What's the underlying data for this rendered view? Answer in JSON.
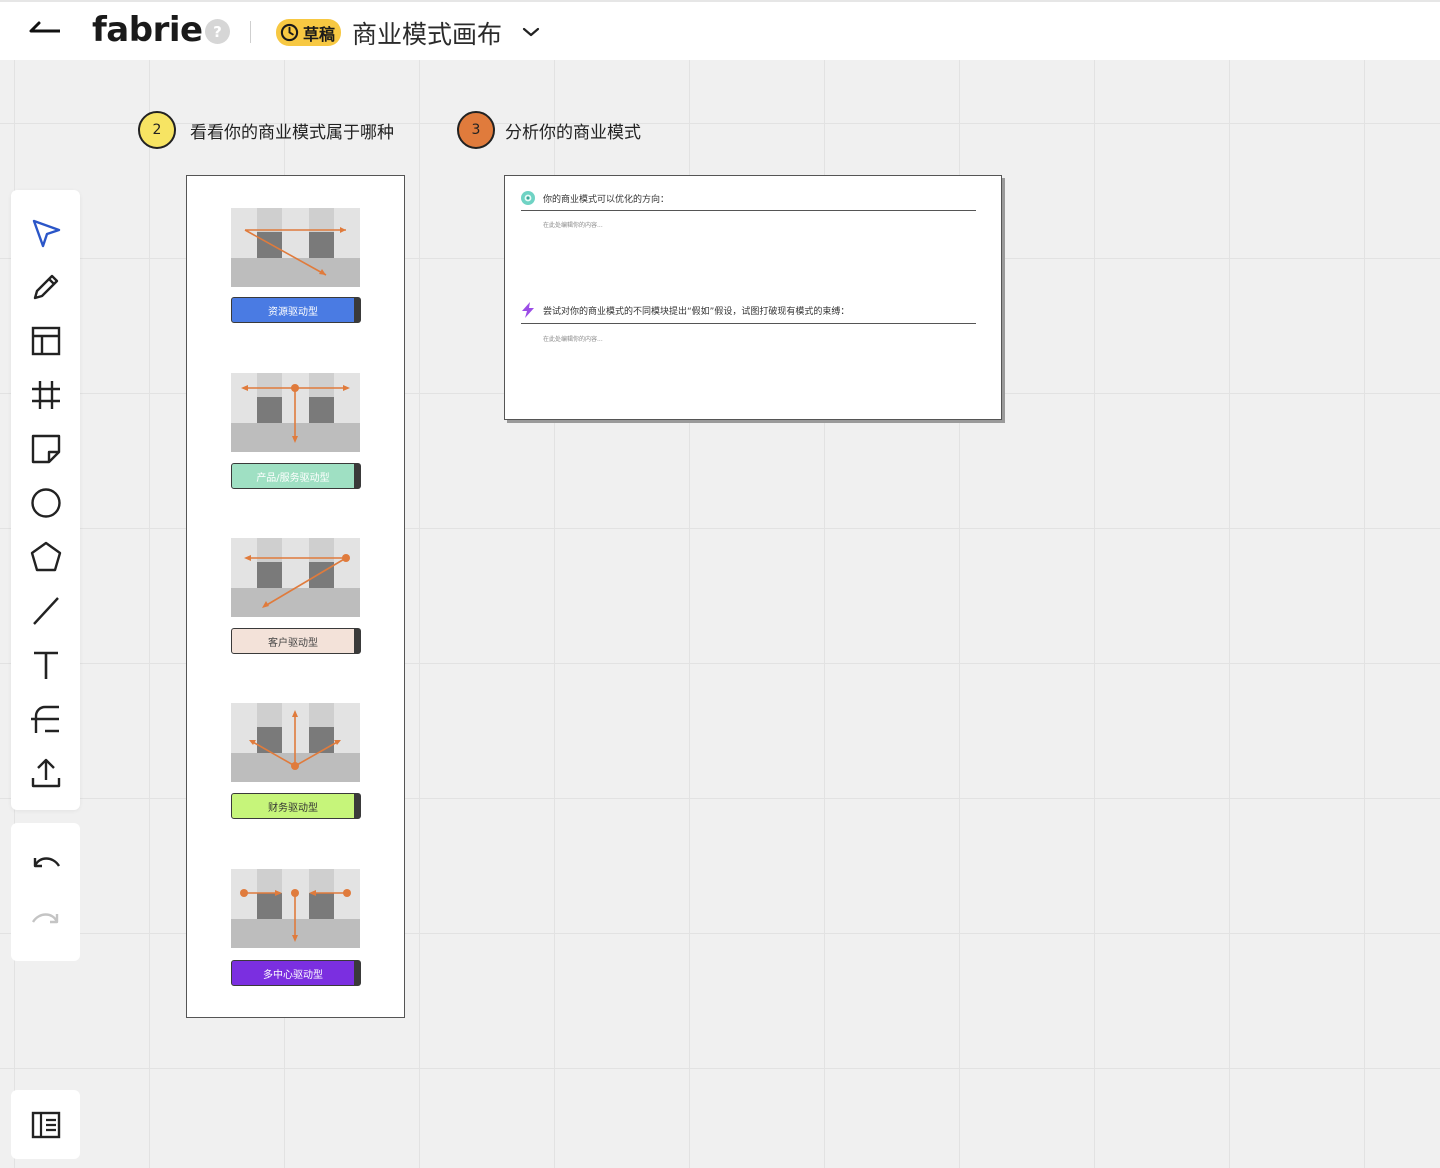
{
  "header": {
    "logo": "fabrie",
    "help": "?",
    "draft_badge": "草稿",
    "doc_title": "商业模式画布"
  },
  "toolbar": {
    "tools": [
      "select-tool",
      "pen-tool",
      "layout-tool",
      "frame-tool",
      "sticky-note-tool",
      "circle-tool",
      "pentagon-tool",
      "line-tool",
      "text-tool",
      "connector-tool",
      "upload-tool"
    ],
    "history": [
      "undo",
      "redo"
    ]
  },
  "steps": [
    {
      "number": "2",
      "title": "看看你的商业模式属于哪种",
      "color": "#f7e463"
    },
    {
      "number": "3",
      "title": "分析你的商业模式",
      "color": "#e07b3c"
    }
  ],
  "models": [
    {
      "label": "资源驱动型",
      "bg": "#4a7be3",
      "fg": "#ffffff"
    },
    {
      "label": "产品/服务驱动型",
      "bg": "#9fe0c3",
      "fg": "#ffffff"
    },
    {
      "label": "客户驱动型",
      "bg": "#f3e2d9",
      "fg": "#444444"
    },
    {
      "label": "财务驱动型",
      "bg": "#c6f57a",
      "fg": "#333333"
    },
    {
      "label": "多中心驱动型",
      "bg": "#7b2fe0",
      "fg": "#ffffff"
    }
  ],
  "analysis": {
    "q1": "你的商业模式可以优化的方向：",
    "q1_placeholder": "在此处编辑你的内容...",
    "q2": "尝试对你的商业模式的不同模块提出“假如”假设，试图打破现有模式的束缚：",
    "q2_placeholder": "在此处编辑你的内容..."
  },
  "colors": {
    "accent_orange": "#e07b3c",
    "draft_yellow": "#f7c842",
    "select_blue": "#2b56c8"
  }
}
